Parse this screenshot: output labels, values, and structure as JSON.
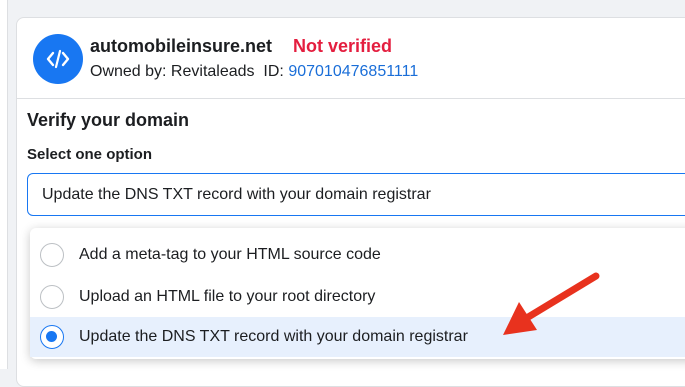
{
  "domain": {
    "avatar_icon": "code-brackets-icon",
    "name": "automobileinsure.net",
    "status": "Not verified",
    "status_color": "#e41e3f",
    "owner_label": "Owned by: Revitaleads",
    "id_label": "ID:",
    "id_value": "907010476851111"
  },
  "verify": {
    "title": "Verify your domain",
    "select_label": "Select one option",
    "selected_value": "Update the DNS TXT record with your domain registrar",
    "options": [
      {
        "label": "Add a meta-tag to your HTML source code",
        "selected": false
      },
      {
        "label": "Upload an HTML file to your root directory",
        "selected": false
      },
      {
        "label": "Update the DNS TXT record with your domain registrar",
        "selected": true
      }
    ]
  },
  "colors": {
    "accent": "#1877f2",
    "annotation_arrow": "#e8321e"
  }
}
